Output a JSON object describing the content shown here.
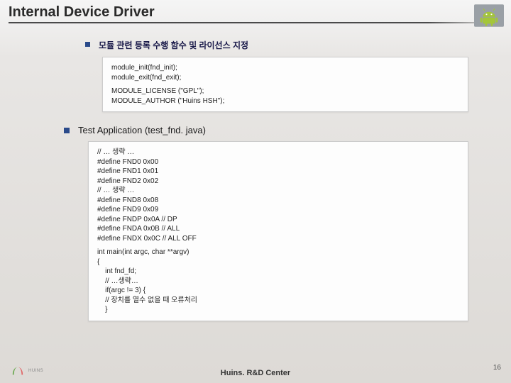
{
  "title": "Internal Device Driver",
  "bullet1": "모듈 관련 등록 수행 함수 및 라이선스 지정",
  "code1a": "module_init(fnd_init);\nmodule_exit(fnd_exit);",
  "code1b": "MODULE_LICENSE (\"GPL\");\nMODULE_AUTHOR (\"Huins HSH\");",
  "bullet2": "Test Application (test_fnd. java)",
  "code2a": "// … 생략 …\n#define FND0 0x00\n#define FND1 0x01\n#define FND2 0x02\n// … 생략 …\n#define FND8 0x08\n#define FND9 0x09\n#define FNDP 0x0A // DP\n#define FNDA 0x0B // ALL\n#define FNDX 0x0C // ALL OFF",
  "code2b": "int main(int argc, char **argv)\n{\n    int fnd_fd;\n    // …생략…\n    if(argc != 3) {\n    // 장치를 열수 없을 때 오류처리\n    }",
  "footer": "Huins. R&D Center",
  "page": "16",
  "logo_text": "HUINS"
}
